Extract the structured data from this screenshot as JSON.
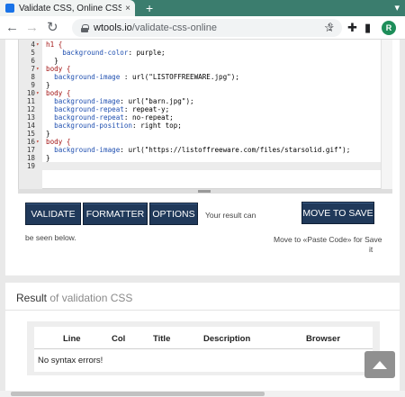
{
  "browser": {
    "tab_title": "Validate CSS, Online CSS Validat",
    "tab_close": "×",
    "new_tab": "+",
    "win_controls": "▾",
    "url_domain": "wtools.io",
    "url_path": "/validate-css-online",
    "avatar_letter": "R",
    "icons": [
      "back-icon",
      "forward-icon",
      "reload-icon",
      "lock-icon",
      "share-icon",
      "star-icon",
      "extensions-icon",
      "sidebar-icon"
    ]
  },
  "editor": {
    "lines": [
      {
        "n": "4",
        "fold": "▾",
        "parts": [
          [
            "sel",
            "h1 {"
          ]
        ]
      },
      {
        "n": "5",
        "fold": "",
        "parts": [
          [
            "prop",
            "    background-color"
          ],
          [
            "val",
            ": purple;"
          ]
        ]
      },
      {
        "n": "6",
        "fold": "",
        "parts": [
          [
            "val",
            "  }"
          ]
        ]
      },
      {
        "n": "7",
        "fold": "▾",
        "parts": [
          [
            "sel",
            "body {"
          ]
        ]
      },
      {
        "n": "8",
        "fold": "",
        "parts": [
          [
            "prop",
            "  background-image "
          ],
          [
            "val",
            ": url(\"LISTOFFREEWARE.jpg\");"
          ]
        ]
      },
      {
        "n": "9",
        "fold": "",
        "parts": [
          [
            "val",
            "}"
          ]
        ]
      },
      {
        "n": "10",
        "fold": "▾",
        "parts": [
          [
            "sel",
            "body {"
          ]
        ]
      },
      {
        "n": "11",
        "fold": "",
        "parts": [
          [
            "prop",
            "  background-image"
          ],
          [
            "val",
            ": url(\"barn.jpg\");"
          ]
        ]
      },
      {
        "n": "12",
        "fold": "",
        "parts": [
          [
            "prop",
            "  background-repeat"
          ],
          [
            "val",
            ": repeat-y;"
          ]
        ]
      },
      {
        "n": "13",
        "fold": "",
        "parts": [
          [
            "prop",
            "  background-repeat"
          ],
          [
            "val",
            ": no-repeat;"
          ]
        ]
      },
      {
        "n": "14",
        "fold": "",
        "parts": [
          [
            "prop",
            "  background-position"
          ],
          [
            "val",
            ": right top;"
          ]
        ]
      },
      {
        "n": "15",
        "fold": "",
        "parts": [
          [
            "val",
            "}"
          ]
        ]
      },
      {
        "n": "16",
        "fold": "▾",
        "parts": [
          [
            "sel",
            "body {"
          ]
        ]
      },
      {
        "n": "17",
        "fold": "",
        "parts": [
          [
            "prop",
            "  background-image"
          ],
          [
            "val",
            ": url(\"https://listoffreeware.com/files/starsolid.gif\");"
          ]
        ]
      },
      {
        "n": "18",
        "fold": "",
        "parts": [
          [
            "val",
            "}"
          ]
        ]
      },
      {
        "n": "19",
        "fold": "",
        "parts": [
          [
            "val",
            ""
          ]
        ]
      }
    ]
  },
  "actions": {
    "validate": "VALIDATE",
    "formatter": "FORMATTER",
    "options": "OPTIONS",
    "move_to_save": "MOVE TO SAVE",
    "result_note_1": "Your result can",
    "result_note_2": "be seen below.",
    "save_note_1": "Move to «Paste Code» for Save",
    "save_note_2": "it"
  },
  "result": {
    "title_main": "Result",
    "title_sub": " of validation CSS",
    "columns": [
      "Line",
      "Col",
      "Title",
      "Description",
      "Browser"
    ],
    "message": "No syntax errors!"
  },
  "colors": {
    "button_bg": "#20395a",
    "tab_strip": "#3b7d6e",
    "avatar": "#1e8e5a"
  }
}
